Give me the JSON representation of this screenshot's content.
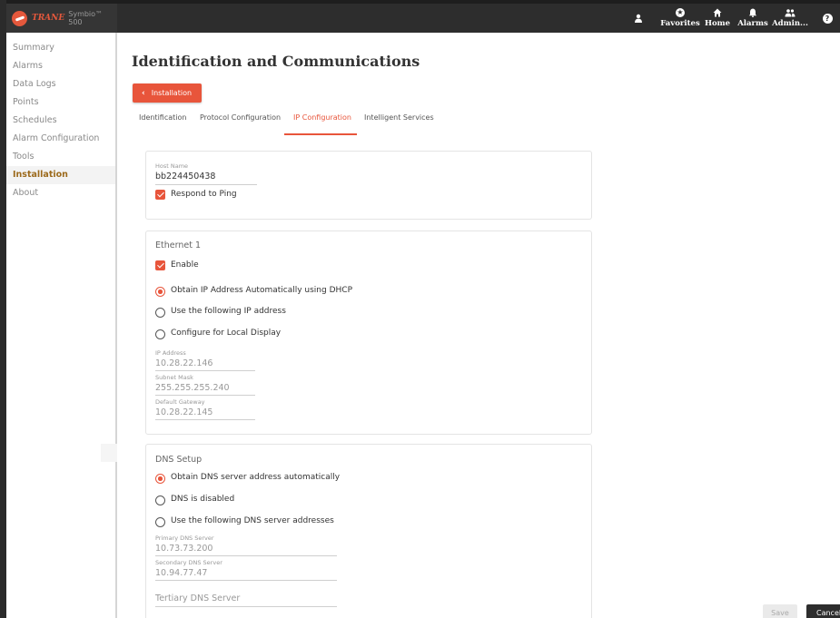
{
  "brand": {
    "company": "TRANE",
    "product": "Symbio™ 500"
  },
  "topnav": {
    "items": [
      {
        "label": "Favorites",
        "icon": "star-circle-icon"
      },
      {
        "label": "Home",
        "icon": "home-icon"
      },
      {
        "label": "Alarms",
        "icon": "bell-icon"
      },
      {
        "label": "Admin...",
        "icon": "users-icon"
      }
    ],
    "user_icon": "user-icon",
    "help_icon": "help-icon"
  },
  "sidebar": {
    "items": [
      {
        "label": "Summary"
      },
      {
        "label": "Alarms"
      },
      {
        "label": "Data Logs"
      },
      {
        "label": "Points"
      },
      {
        "label": "Schedules"
      },
      {
        "label": "Alarm Configuration"
      },
      {
        "label": "Tools"
      },
      {
        "label": "Installation",
        "active": true
      },
      {
        "label": "About"
      }
    ]
  },
  "page": {
    "title": "Identification and Communications",
    "back_button": "Installation",
    "tabs": [
      {
        "label": "Identification"
      },
      {
        "label": "Protocol Configuration"
      },
      {
        "label": "IP Configuration",
        "active": true
      },
      {
        "label": "Intelligent Services"
      }
    ]
  },
  "host": {
    "host_name_label": "Host Name",
    "host_name_value": "bb224450438",
    "respond_to_ping_label": "Respond to Ping",
    "respond_to_ping_checked": true
  },
  "ethernet": {
    "title": "Ethernet 1",
    "enable_label": "Enable",
    "enable_checked": true,
    "options": [
      {
        "label": "Obtain IP Address Automatically using DHCP",
        "selected": true
      },
      {
        "label": "Use the following IP address",
        "selected": false
      },
      {
        "label": "Configure for Local Display",
        "selected": false
      }
    ],
    "ip_address_label": "IP Address",
    "ip_address_value": "10.28.22.146",
    "subnet_mask_label": "Subnet Mask",
    "subnet_mask_value": "255.255.255.240",
    "gateway_label": "Default Gateway",
    "gateway_value": "10.28.22.145"
  },
  "dns": {
    "title": "DNS Setup",
    "options": [
      {
        "label": "Obtain DNS server address automatically",
        "selected": true
      },
      {
        "label": "DNS is disabled",
        "selected": false
      },
      {
        "label": "Use the following DNS server addresses",
        "selected": false
      }
    ],
    "primary_label": "Primary DNS Server",
    "primary_value": "10.73.73.200",
    "secondary_label": "Secondary DNS Server",
    "secondary_value": "10.94.77.47",
    "tertiary_placeholder": "Tertiary DNS Server"
  },
  "actions": {
    "save_label": "Save",
    "cancel_label": "Cancel"
  },
  "colors": {
    "accent": "#e8553b",
    "topbar": "#2d2d2d",
    "active_sidebar_text": "#9c6a1c"
  }
}
